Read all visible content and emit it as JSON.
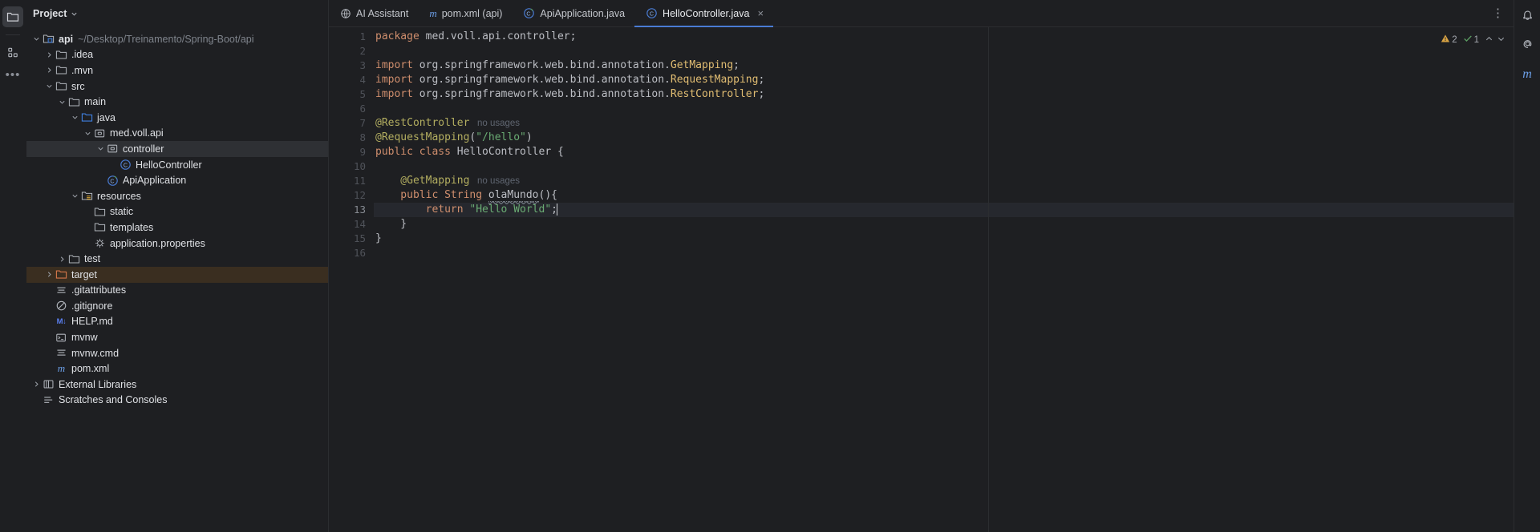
{
  "window": {
    "theme_bg": "#1e1f22",
    "accent": "#4a7cd4"
  },
  "activity_bar": {
    "items": [
      {
        "name": "project-tool-window",
        "icon": "folder-icon",
        "active": true
      },
      {
        "name": "structure-tool-window",
        "icon": "grid-squares-icon",
        "active": false
      },
      {
        "name": "more-tool-windows",
        "icon": "ellipsis-icon",
        "active": false
      }
    ]
  },
  "project_panel": {
    "title": "Project",
    "dropdown_icon": "chevron-down-icon",
    "tree": [
      {
        "label": "api",
        "hint": "~/Desktop/Treinamento/Spring-Boot/api",
        "depth": 0,
        "arrow": "down",
        "icon": "module-folder-icon",
        "bold": true,
        "state": "normal"
      },
      {
        "label": ".idea",
        "hint": "",
        "depth": 1,
        "arrow": "right",
        "icon": "folder-icon",
        "bold": false,
        "state": "normal"
      },
      {
        "label": ".mvn",
        "hint": "",
        "depth": 1,
        "arrow": "right",
        "icon": "folder-icon",
        "bold": false,
        "state": "normal"
      },
      {
        "label": "src",
        "hint": "",
        "depth": 1,
        "arrow": "down",
        "icon": "folder-icon",
        "bold": false,
        "state": "normal"
      },
      {
        "label": "main",
        "hint": "",
        "depth": 2,
        "arrow": "down",
        "icon": "folder-icon",
        "bold": false,
        "state": "normal"
      },
      {
        "label": "java",
        "hint": "",
        "depth": 3,
        "arrow": "down",
        "icon": "source-root-folder-icon",
        "bold": false,
        "state": "normal"
      },
      {
        "label": "med.voll.api",
        "hint": "",
        "depth": 4,
        "arrow": "down",
        "icon": "package-icon",
        "bold": false,
        "state": "normal"
      },
      {
        "label": "controller",
        "hint": "",
        "depth": 5,
        "arrow": "down",
        "icon": "package-icon",
        "bold": false,
        "state": "selected"
      },
      {
        "label": "HelloController",
        "hint": "",
        "depth": 6,
        "arrow": "none",
        "icon": "java-class-icon",
        "bold": false,
        "state": "normal"
      },
      {
        "label": "ApiApplication",
        "hint": "",
        "depth": 5,
        "arrow": "none",
        "icon": "spring-boot-class-icon",
        "bold": false,
        "state": "normal"
      },
      {
        "label": "resources",
        "hint": "",
        "depth": 3,
        "arrow": "down",
        "icon": "resources-folder-icon",
        "bold": false,
        "state": "normal"
      },
      {
        "label": "static",
        "hint": "",
        "depth": 4,
        "arrow": "none",
        "icon": "folder-icon",
        "bold": false,
        "state": "normal"
      },
      {
        "label": "templates",
        "hint": "",
        "depth": 4,
        "arrow": "none",
        "icon": "folder-icon",
        "bold": false,
        "state": "normal"
      },
      {
        "label": "application.properties",
        "hint": "",
        "depth": 4,
        "arrow": "none",
        "icon": "properties-file-icon",
        "bold": false,
        "state": "normal"
      },
      {
        "label": "test",
        "hint": "",
        "depth": 2,
        "arrow": "right",
        "icon": "folder-icon",
        "bold": false,
        "state": "normal"
      },
      {
        "label": "target",
        "hint": "",
        "depth": 1,
        "arrow": "right",
        "icon": "excluded-folder-icon",
        "bold": false,
        "state": "excluded"
      },
      {
        "label": ".gitattributes",
        "hint": "",
        "depth": 1,
        "arrow": "none",
        "icon": "text-file-icon",
        "bold": false,
        "state": "normal"
      },
      {
        "label": ".gitignore",
        "hint": "",
        "depth": 1,
        "arrow": "none",
        "icon": "ignore-file-icon",
        "bold": false,
        "state": "normal"
      },
      {
        "label": "HELP.md",
        "hint": "",
        "depth": 1,
        "arrow": "none",
        "icon": "markdown-file-icon",
        "bold": false,
        "state": "normal"
      },
      {
        "label": "mvnw",
        "hint": "",
        "depth": 1,
        "arrow": "none",
        "icon": "shell-script-icon",
        "bold": false,
        "state": "normal"
      },
      {
        "label": "mvnw.cmd",
        "hint": "",
        "depth": 1,
        "arrow": "none",
        "icon": "text-file-icon",
        "bold": false,
        "state": "normal"
      },
      {
        "label": "pom.xml",
        "hint": "",
        "depth": 1,
        "arrow": "none",
        "icon": "maven-file-icon",
        "bold": false,
        "state": "normal"
      },
      {
        "label": "External Libraries",
        "hint": "",
        "depth": 0,
        "arrow": "right",
        "icon": "libraries-icon",
        "bold": false,
        "state": "normal"
      },
      {
        "label": "Scratches and Consoles",
        "hint": "",
        "depth": 0,
        "arrow": "none",
        "icon": "scratches-icon",
        "bold": false,
        "state": "normal"
      }
    ]
  },
  "editor": {
    "tabs": [
      {
        "label": "AI Assistant",
        "icon": "ai-globe-icon",
        "active": false,
        "closable": false
      },
      {
        "label": "pom.xml (api)",
        "icon": "maven-file-icon",
        "active": false,
        "closable": false
      },
      {
        "label": "ApiApplication.java",
        "icon": "spring-boot-class-icon",
        "active": false,
        "closable": false
      },
      {
        "label": "HelloController.java",
        "icon": "java-class-icon",
        "active": true,
        "closable": true
      }
    ],
    "tab_close_icon": "close-icon",
    "options_icon": "kebab-menu-icon",
    "inspections": {
      "warning_icon": "warning-triangle-icon",
      "warning_count": "2",
      "ok_icon": "checkmark-icon",
      "ok_count": "1",
      "prev_icon": "chevron-up-icon",
      "next_icon": "chevron-down-icon"
    },
    "gutter": {
      "line_numbers": [
        "1",
        "2",
        "3",
        "4",
        "5",
        "6",
        "7",
        "8",
        "9",
        "10",
        "11",
        "12",
        "13",
        "14",
        "15",
        "16"
      ],
      "current_line": 13,
      "bulb_line": 13,
      "bulb_icon": "lightbulb-icon"
    },
    "filename": "HelloController.java",
    "code_lines": [
      {
        "n": 1,
        "tokens": [
          {
            "t": "package ",
            "c": "kw"
          },
          {
            "t": "med.voll.api.controller;",
            "c": "plain"
          }
        ]
      },
      {
        "n": 2,
        "tokens": []
      },
      {
        "n": 3,
        "tokens": [
          {
            "t": "import ",
            "c": "kw"
          },
          {
            "t": "org.springframework.web.bind.annotation.",
            "c": "plain"
          },
          {
            "t": "GetMapping",
            "c": "type"
          },
          {
            "t": ";",
            "c": "plain"
          }
        ]
      },
      {
        "n": 4,
        "tokens": [
          {
            "t": "import ",
            "c": "kw"
          },
          {
            "t": "org.springframework.web.bind.annotation.",
            "c": "plain"
          },
          {
            "t": "RequestMapping",
            "c": "type"
          },
          {
            "t": ";",
            "c": "plain"
          }
        ]
      },
      {
        "n": 5,
        "tokens": [
          {
            "t": "import ",
            "c": "kw"
          },
          {
            "t": "org.springframework.web.bind.annotation.",
            "c": "plain"
          },
          {
            "t": "RestController",
            "c": "type"
          },
          {
            "t": ";",
            "c": "plain"
          }
        ]
      },
      {
        "n": 6,
        "tokens": []
      },
      {
        "n": 7,
        "tokens": [
          {
            "t": "@RestController",
            "c": "anno"
          },
          {
            "t": "   no usages",
            "c": "hint"
          }
        ]
      },
      {
        "n": 8,
        "tokens": [
          {
            "t": "@RequestMapping",
            "c": "anno"
          },
          {
            "t": "(",
            "c": "plain"
          },
          {
            "t": "\"/hello\"",
            "c": "str"
          },
          {
            "t": ")",
            "c": "plain"
          }
        ]
      },
      {
        "n": 9,
        "tokens": [
          {
            "t": "public class ",
            "c": "kw"
          },
          {
            "t": "HelloController ",
            "c": "cls"
          },
          {
            "t": "{",
            "c": "plain"
          }
        ]
      },
      {
        "n": 10,
        "tokens": []
      },
      {
        "n": 11,
        "tokens": [
          {
            "t": "    @GetMapping",
            "c": "anno"
          },
          {
            "t": "   no usages",
            "c": "hint"
          }
        ]
      },
      {
        "n": 12,
        "tokens": [
          {
            "t": "    public String ",
            "c": "kw"
          },
          {
            "t": "olaMundo",
            "c": "method"
          },
          {
            "t": "(){",
            "c": "plain"
          }
        ]
      },
      {
        "n": 13,
        "tokens": [
          {
            "t": "        return ",
            "c": "kw"
          },
          {
            "t": "\"Hello World\"",
            "c": "str"
          },
          {
            "t": ";",
            "c": "plain"
          }
        ]
      },
      {
        "n": 14,
        "tokens": [
          {
            "t": "    }",
            "c": "plain"
          }
        ]
      },
      {
        "n": 15,
        "tokens": [
          {
            "t": "}",
            "c": "plain"
          }
        ]
      },
      {
        "n": 16,
        "tokens": []
      }
    ]
  },
  "right_bar": {
    "items": [
      {
        "name": "notifications",
        "icon": "bell-icon"
      },
      {
        "name": "ai-assistant",
        "icon": "at-icon"
      },
      {
        "name": "maven",
        "icon": "maven-m-icon"
      }
    ]
  }
}
